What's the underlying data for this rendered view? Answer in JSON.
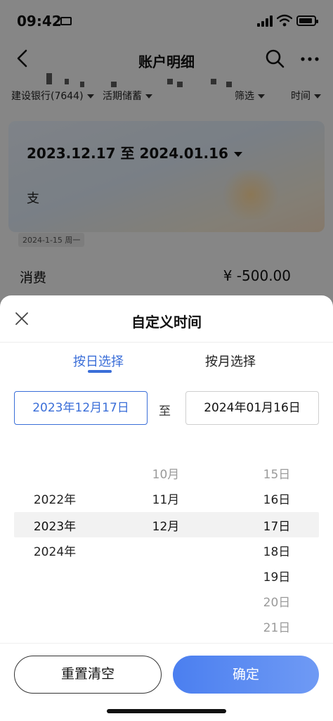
{
  "status_bar": {
    "time": "09:42"
  },
  "nav": {
    "title": "账户明细"
  },
  "filters": {
    "account": "建设银行(7644)",
    "type": "活期储蓄",
    "filter": "筛选",
    "time": "时间"
  },
  "card": {
    "date_range": "2023.12.17 至 2024.01.16",
    "sub_label": "支"
  },
  "transaction": {
    "day_tag": "2024-1-15 周一",
    "label": "消费",
    "amount": "¥ -500.00"
  },
  "sheet": {
    "title": "自定义时间",
    "tabs": [
      {
        "label": "按日选择",
        "active": true
      },
      {
        "label": "按月选择",
        "active": false
      }
    ],
    "start_date": "2023年12月17日",
    "separator": "至",
    "end_date": "2024年01月16日",
    "picker": {
      "years": [
        "2022年",
        "2023年",
        "2024年"
      ],
      "months": [
        "10月",
        "11月",
        "12月"
      ],
      "days": [
        "15日",
        "16日",
        "17日",
        "18日",
        "19日",
        "20日",
        "21日"
      ]
    },
    "reset_button": "重置清空",
    "confirm_button": "确定"
  },
  "colors": {
    "accent": "#3a6ed8",
    "confirm_gradient_start": "#4b7ff0",
    "confirm_gradient_end": "#6f9af4"
  }
}
